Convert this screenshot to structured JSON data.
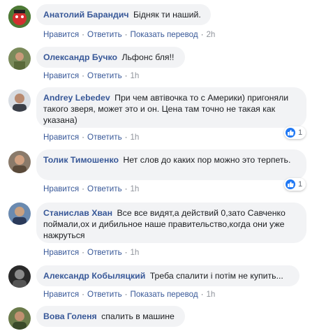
{
  "actions": {
    "like": "Нравится",
    "reply": "Ответить",
    "translate": "Показать перевод",
    "sep": "·"
  },
  "comments": [
    {
      "author": "Анатолий Барандич",
      "text": "Бідняк ти наший.",
      "time": "2h",
      "has_translate": true
    },
    {
      "author": "Олександр Бучко",
      "text": "Льфонс бля!!",
      "time": "1h",
      "has_translate": false
    },
    {
      "author": "Andrey Lebedev",
      "text": "При чем автівочка то с Америки) пригоняли такого зверя, может это и он. Цена там точно не такая как указана)",
      "time": "1h",
      "has_translate": false,
      "reactions": "1"
    },
    {
      "author": "Толик Тимошенко",
      "text": "Нет слов до каких пор можно это терпеть.",
      "time": "1h",
      "has_translate": false,
      "reactions": "1"
    },
    {
      "author": "Станислав Хван",
      "text": "Все все видят,а действий 0,зато Савченко поймали,ох и дибильное наше правительство,когда они уже нажруться",
      "time": "1h",
      "has_translate": false
    },
    {
      "author": "Александр Кобыляцкий",
      "text": "Треба спалити і потім не купить...",
      "time": "1h",
      "has_translate": true
    },
    {
      "author": "Вова Голеня",
      "text": "спалить в машине",
      "time": "",
      "has_translate": false
    }
  ],
  "colors": {
    "link": "#385898",
    "bubble": "#f2f3f5",
    "like": "#2078f4"
  },
  "icons": [
    "like-icon"
  ]
}
